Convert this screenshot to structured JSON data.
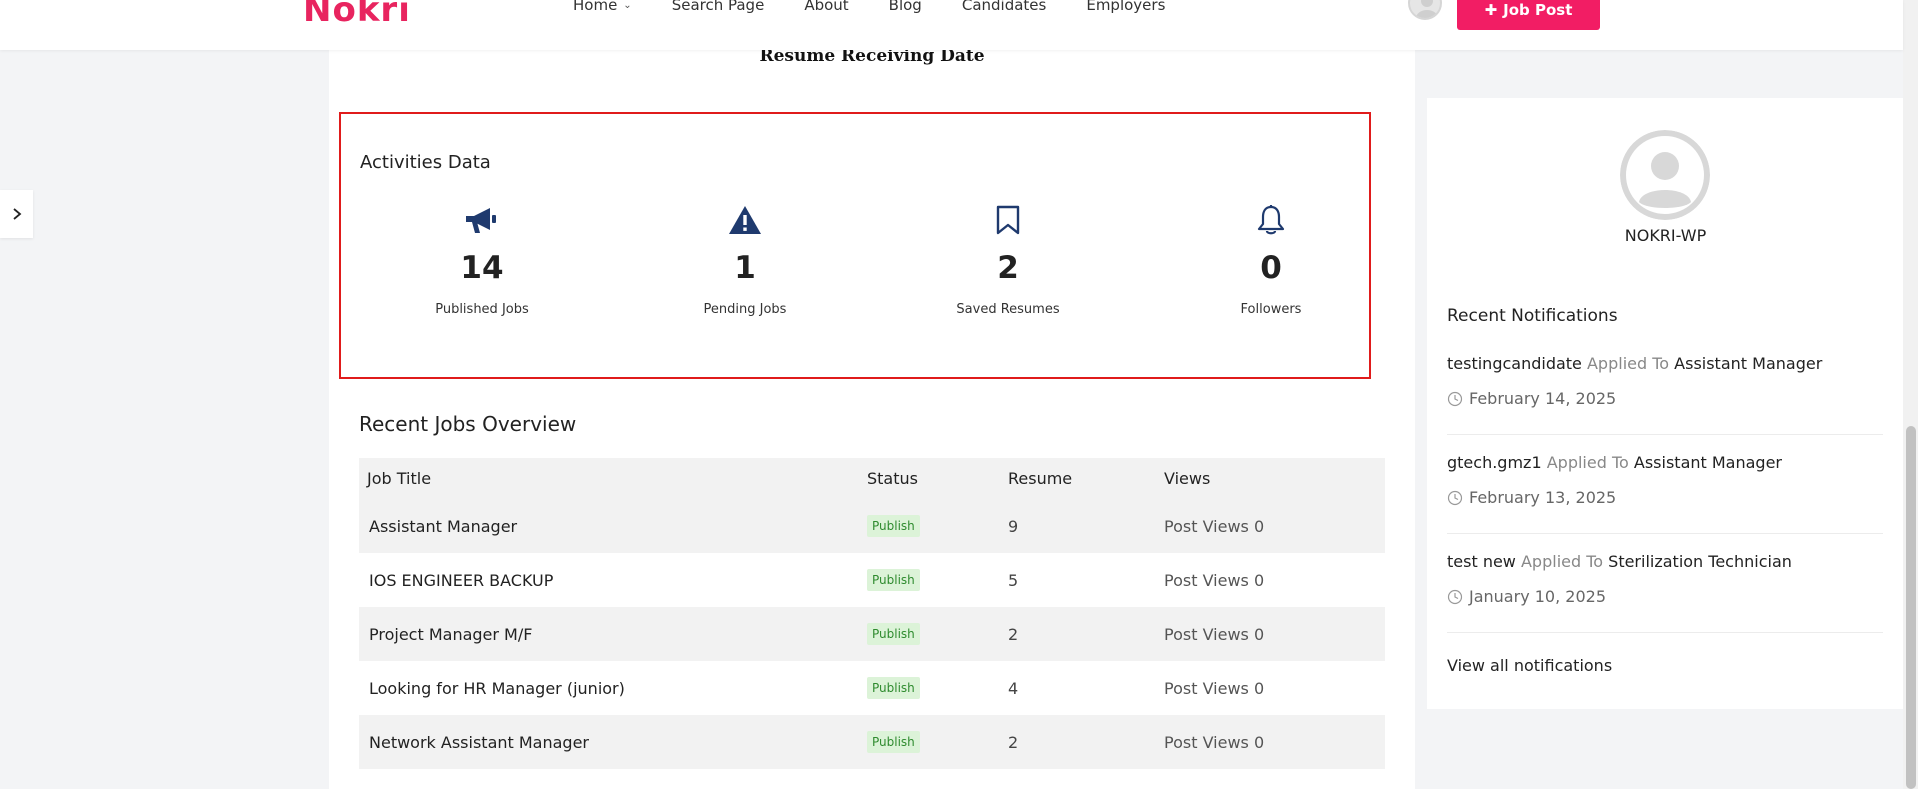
{
  "header": {
    "logo": "Nokri",
    "nav": [
      "Home",
      "Search Page",
      "About",
      "Blog",
      "Candidates",
      "Employers"
    ],
    "job_post_label": "Job Post"
  },
  "main": {
    "resume_date_heading": "Resume Receiving Date",
    "activities": {
      "title": "Activities Data",
      "stats": [
        {
          "value": "14",
          "label": "Published Jobs",
          "icon": "megaphone-icon"
        },
        {
          "value": "1",
          "label": "Pending Jobs",
          "icon": "warning-icon"
        },
        {
          "value": "2",
          "label": "Saved Resumes",
          "icon": "bookmark-icon"
        },
        {
          "value": "0",
          "label": "Followers",
          "icon": "bell-icon"
        }
      ]
    },
    "recent_jobs": {
      "title": "Recent Jobs Overview",
      "columns": [
        "Job Title",
        "Status",
        "Resume",
        "Views"
      ],
      "rows": [
        {
          "title": "Assistant Manager",
          "status": "Publish",
          "resume": "9",
          "views": "Post Views 0"
        },
        {
          "title": "IOS ENGINEER BACKUP",
          "status": "Publish",
          "resume": "5",
          "views": "Post Views 0"
        },
        {
          "title": "Project Manager M/F",
          "status": "Publish",
          "resume": "2",
          "views": "Post Views 0"
        },
        {
          "title": "Looking for HR Manager (junior)",
          "status": "Publish",
          "resume": "4",
          "views": "Post Views 0"
        },
        {
          "title": "Network Assistant Manager",
          "status": "Publish",
          "resume": "2",
          "views": "Post Views 0"
        }
      ]
    }
  },
  "sidebar": {
    "profile_name": "NOKRI-WP",
    "notifications_heading": "Recent Notifications",
    "notifications": [
      {
        "user": "testingcandidate",
        "action": "Applied To",
        "job": "Assistant Manager",
        "date": "February 14, 2025"
      },
      {
        "user": "gtech.gmz1",
        "action": "Applied To",
        "job": "Assistant Manager",
        "date": "February 13, 2025"
      },
      {
        "user": "test new",
        "action": "Applied To",
        "job": "Sterilization Technician",
        "date": "January 10, 2025"
      }
    ],
    "view_all_label": "View all notifications"
  },
  "colors": {
    "brand": "#f21d64",
    "icon_navy": "#1f3a6e",
    "highlight_border": "#e01b1b",
    "badge_bg": "#dcf3d8",
    "badge_text": "#2e8b2e"
  }
}
